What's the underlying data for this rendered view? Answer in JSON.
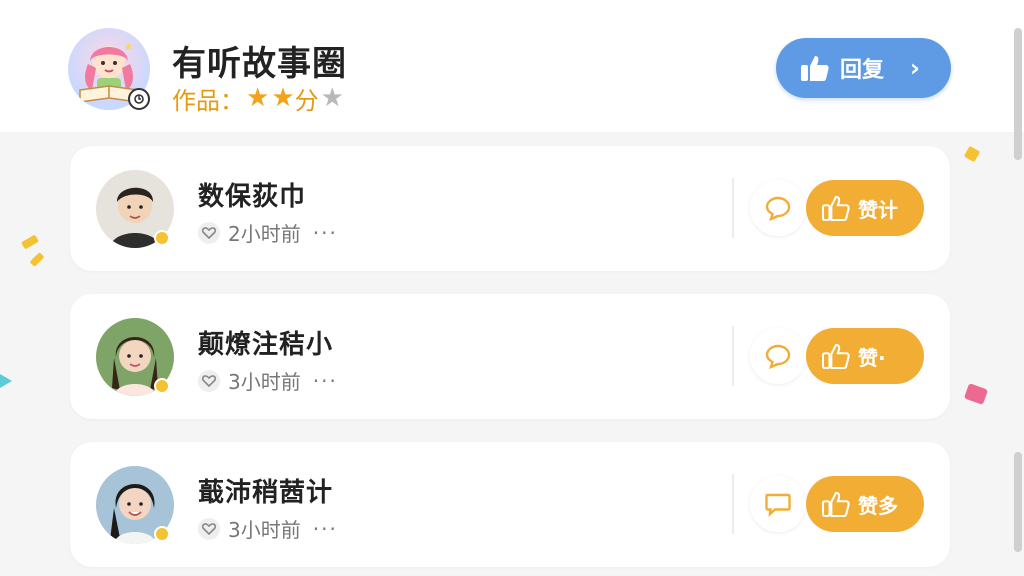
{
  "header": {
    "title": "有听故事圈",
    "rating_label": "作品：",
    "rating_suffix": "分",
    "rating_stars": 2,
    "rating_max": 3,
    "reply_button": "回复"
  },
  "posts": [
    {
      "name": "数保荻巾",
      "time": "2小时前",
      "like_label": "赞计",
      "comment_color": "#f2ad34"
    },
    {
      "name": "颠燎注秸小",
      "time": "3小时前",
      "like_label": "赞·",
      "comment_color": "#f2ad34"
    },
    {
      "name": "蕺沛稍莤计",
      "time": "3小时前",
      "like_label": "赞多",
      "comment_color": "#f2ad34"
    }
  ],
  "colors": {
    "accent_blue": "#5f9be5",
    "accent_orange": "#f2ad34",
    "online": "#f5c231"
  }
}
